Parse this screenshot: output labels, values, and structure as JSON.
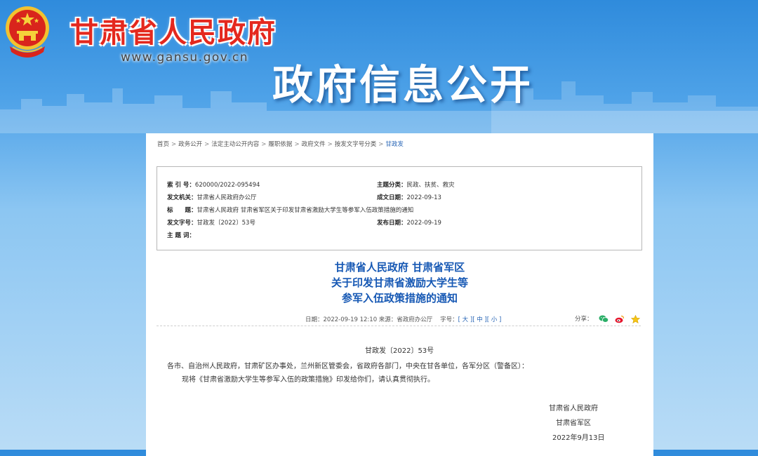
{
  "header": {
    "site_name": "甘肃省人民政府",
    "site_url": "www.gansu.gov.cn",
    "banner_title": "政府信息公开"
  },
  "breadcrumb": [
    {
      "label": "首页"
    },
    {
      "label": "政务公开"
    },
    {
      "label": "法定主动公开内容"
    },
    {
      "label": "履职依据"
    },
    {
      "label": "政府文件"
    },
    {
      "label": "按发文字号分类"
    },
    {
      "label": "甘政发",
      "current": true
    }
  ],
  "meta": {
    "index_label": "索 引 号：",
    "index_value": "620000/2022-095494",
    "topic_label": "主题分类：",
    "topic_value": "民政、扶贫、救灾",
    "issuer_label": "发文机关：",
    "issuer_value": "甘肃省人民政府办公厅",
    "created_label": "成文日期：",
    "created_value": "2022-09-13",
    "title_label": "标　　题：",
    "title_value": "甘肃省人民政府 甘肃省军区关于印发甘肃省激励大学生等参军入伍政策措施的通知",
    "docno_label": "发文字号：",
    "docno_value": "甘政发〔2022〕53号",
    "published_label": "发布日期：",
    "published_value": "2022-09-19",
    "keywords_label": "主 题 词：",
    "keywords_value": ""
  },
  "document": {
    "title_line1": "甘肃省人民政府 甘肃省军区",
    "title_line2": "关于印发甘肃省激励大学生等",
    "title_line3": "参军入伍政策措施的通知",
    "date_info": "日期：2022-09-19 12:10  来源：省政府办公厅",
    "font_size_label": "字号：",
    "font_large": "[ 大 ]",
    "font_medium": "[ 中 ]",
    "font_small": "[ 小 ]",
    "share_label": "分享：",
    "doc_number": "甘政发〔2022〕53号",
    "recipients": "各市、自治州人民政府，甘肃矿区办事处，兰州新区管委会，省政府各部门，中央在甘各单位，各军分区（警备区）：",
    "paragraph1": "现将《甘肃省激励大学生等参军入伍的政策措施》印发给你们，请认真贯彻执行。",
    "signer1": "甘肃省人民政府",
    "signer2": "甘肃省军区",
    "sign_date": "2022年9月13日"
  },
  "colors": {
    "title_blue": "#1658b4",
    "site_red": "#e4281e",
    "link_blue": "#2563b5"
  },
  "icons": {
    "emblem": "national-emblem",
    "share": [
      "wechat-icon",
      "weibo-icon",
      "favorite-star-icon"
    ]
  }
}
